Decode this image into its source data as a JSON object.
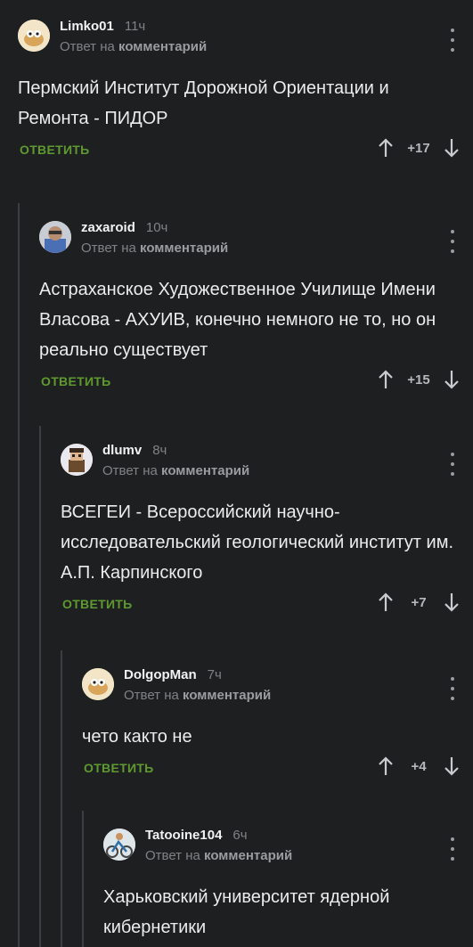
{
  "colors": {
    "background": "#1d1f21",
    "reply_accent": "#5f9a2f",
    "thread_line": "#3b3d40",
    "muted": "#808285"
  },
  "icons": {
    "menu": "vertical-ellipsis-icon",
    "upvote": "arrow-up-icon",
    "downvote": "arrow-down-icon"
  },
  "comments": [
    {
      "author": "Limko01",
      "time": "11ч",
      "reply_prefix": "Ответ на",
      "reply_link": "комментарий",
      "text": "Пермский Институт Дорожной Ориентации и Ремонта - ПИДОР",
      "reply_label": "ОТВЕТИТЬ",
      "score": "+17"
    },
    {
      "author": "zaxaroid",
      "time": "10ч",
      "reply_prefix": "Ответ на",
      "reply_link": "комментарий",
      "text": "Астраханское Художественное Училище Имени Власова - АХУИВ, конечно немного не то, но он реально существует",
      "reply_label": "ОТВЕТИТЬ",
      "score": "+15"
    },
    {
      "author": "dlumv",
      "time": "8ч",
      "reply_prefix": "Ответ на",
      "reply_link": "комментарий",
      "text": "ВСЕГЕИ - Всероссийский научно-исследовательский геологический институт им. А.П. Карпинского",
      "reply_label": "ОТВЕТИТЬ",
      "score": "+7"
    },
    {
      "author": "DolgopMan",
      "time": "7ч",
      "reply_prefix": "Ответ на",
      "reply_link": "комментарий",
      "text": "чето както не",
      "reply_label": "ОТВЕТИТЬ",
      "score": "+4"
    },
    {
      "author": "Tatooine104",
      "time": "6ч",
      "reply_prefix": "Ответ на",
      "reply_link": "комментарий",
      "text": "Харьковский университет ядерной кибернетики",
      "reply_label": "",
      "score": ""
    }
  ]
}
